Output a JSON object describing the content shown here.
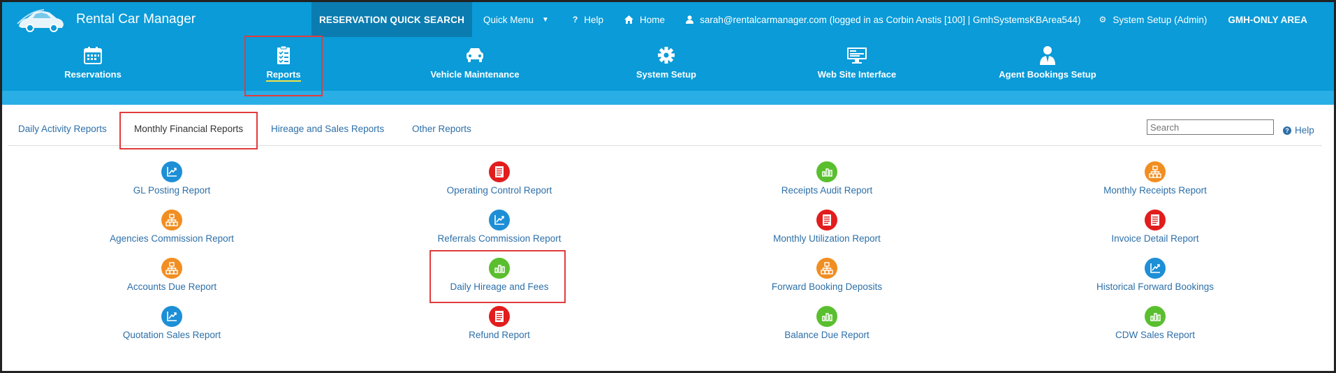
{
  "app": {
    "title": "Rental Car Manager"
  },
  "topnav": {
    "quick_search": "RESERVATION QUICK SEARCH",
    "quick_menu": "Quick Menu",
    "help": "Help",
    "home": "Home",
    "user": "sarah@rentalcarmanager.com (logged in as Corbin Anstis [100] | GmhSystemsKBArea544)",
    "system_setup": "System Setup (Admin)",
    "gmh_area": "GMH-ONLY AREA"
  },
  "modules": [
    {
      "label": "Reservations",
      "icon": "calendar-icon"
    },
    {
      "label": "Reports",
      "icon": "clipboard-icon"
    },
    {
      "label": "Vehicle Maintenance",
      "icon": "car-icon"
    },
    {
      "label": "System Setup",
      "icon": "gear-icon"
    },
    {
      "label": "Web Site Interface",
      "icon": "monitor-icon"
    },
    {
      "label": "Agent Bookings Setup",
      "icon": "agent-icon"
    }
  ],
  "tabs": [
    {
      "label": "Daily Activity Reports"
    },
    {
      "label": "Monthly Financial Reports"
    },
    {
      "label": "Hireage and Sales Reports"
    },
    {
      "label": "Other Reports"
    }
  ],
  "search": {
    "placeholder": "Search"
  },
  "help_link": "Help",
  "reports": [
    {
      "label": "GL Posting Report",
      "icon": "chart-trend-icon",
      "color": "#1d8fd6"
    },
    {
      "label": "Operating Control Report",
      "icon": "document-icon",
      "color": "#e21d1d"
    },
    {
      "label": "Receipts Audit Report",
      "icon": "bar-chart-icon",
      "color": "#5abf2e"
    },
    {
      "label": "Monthly Receipts Report",
      "icon": "hierarchy-icon",
      "color": "#f18e22"
    },
    {
      "label": "Agencies Commission Report",
      "icon": "hierarchy-icon",
      "color": "#f18e22"
    },
    {
      "label": "Referrals Commission Report",
      "icon": "chart-trend-icon",
      "color": "#1d8fd6"
    },
    {
      "label": "Monthly Utilization Report",
      "icon": "document-icon",
      "color": "#e21d1d"
    },
    {
      "label": "Invoice Detail Report",
      "icon": "document-icon",
      "color": "#e21d1d"
    },
    {
      "label": "Accounts Due Report",
      "icon": "hierarchy-icon",
      "color": "#f18e22"
    },
    {
      "label": "Daily Hireage and Fees",
      "icon": "bar-chart-icon",
      "color": "#5abf2e"
    },
    {
      "label": "Forward Booking Deposits",
      "icon": "hierarchy-icon",
      "color": "#f18e22"
    },
    {
      "label": "Historical Forward Bookings",
      "icon": "chart-trend-icon",
      "color": "#1d8fd6"
    },
    {
      "label": "Quotation Sales Report",
      "icon": "chart-trend-icon",
      "color": "#1d8fd6"
    },
    {
      "label": "Refund Report",
      "icon": "document-icon",
      "color": "#e21d1d"
    },
    {
      "label": "Balance Due Report",
      "icon": "bar-chart-icon",
      "color": "#5abf2e"
    },
    {
      "label": "CDW Sales Report",
      "icon": "bar-chart-icon",
      "color": "#5abf2e"
    }
  ]
}
